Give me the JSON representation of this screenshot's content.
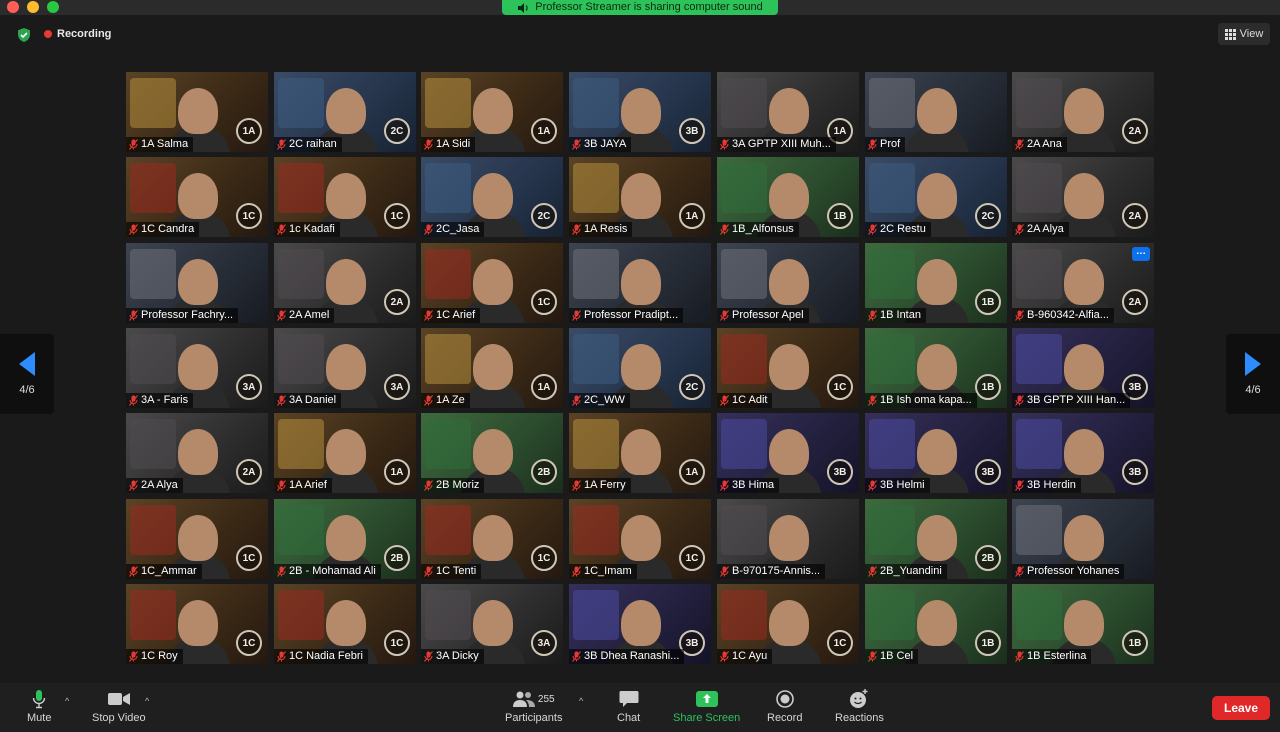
{
  "window": {
    "sharing_banner": "Professor Streamer is sharing computer sound",
    "recording_label": "Recording",
    "view_label": "View",
    "page_indicator": "4/6"
  },
  "participants": [
    {
      "name": "1A Salma",
      "badge": "1A",
      "house": "gold"
    },
    {
      "name": "2C raihan",
      "badge": "2C",
      "house": "blue"
    },
    {
      "name": "1A Sidi",
      "badge": "1A",
      "house": "gold"
    },
    {
      "name": "3B JAYA",
      "badge": "3B",
      "house": "blue"
    },
    {
      "name": "3A GPTP XIII Muh...",
      "badge": "1A",
      "house": "dark"
    },
    {
      "name": "Prof",
      "badge": "",
      "house": "prof"
    },
    {
      "name": "2A Ana",
      "badge": "2A",
      "house": "dark"
    },
    {
      "name": "1C Candra",
      "badge": "1C",
      "house": "red"
    },
    {
      "name": "1c Kadafi",
      "badge": "1C",
      "house": "red"
    },
    {
      "name": "2C_Jasa",
      "badge": "2C",
      "house": "blue"
    },
    {
      "name": "1A Resis",
      "badge": "1A",
      "house": "gold"
    },
    {
      "name": "1B_Alfonsus",
      "badge": "1B",
      "house": "green"
    },
    {
      "name": "2C Restu",
      "badge": "2C",
      "house": "blue"
    },
    {
      "name": "2A Alya",
      "badge": "2A",
      "house": "dark"
    },
    {
      "name": "Professor Fachry...",
      "badge": "",
      "house": "prof"
    },
    {
      "name": "2A Amel",
      "badge": "2A",
      "house": "dark"
    },
    {
      "name": "1C Arief",
      "badge": "1C",
      "house": "red"
    },
    {
      "name": "Professor Pradipt...",
      "badge": "",
      "house": "prof"
    },
    {
      "name": "Professor Apel",
      "badge": "",
      "house": "prof"
    },
    {
      "name": "1B Intan",
      "badge": "1B",
      "house": "green"
    },
    {
      "name": "B-960342-Alfia...",
      "badge": "2A",
      "house": "dark",
      "more": true
    },
    {
      "name": "3A - Faris",
      "badge": "3A",
      "house": "dark"
    },
    {
      "name": "3A Daniel",
      "badge": "3A",
      "house": "dark"
    },
    {
      "name": "1A Ze",
      "badge": "1A",
      "house": "gold"
    },
    {
      "name": "2C_WW",
      "badge": "2C",
      "house": "blue"
    },
    {
      "name": "1C Adit",
      "badge": "1C",
      "house": "red"
    },
    {
      "name": "1B Ish oma kapa...",
      "badge": "1B",
      "house": "green"
    },
    {
      "name": "3B GPTP XIII Han...",
      "badge": "3B",
      "house": "purple"
    },
    {
      "name": "2A Alya",
      "badge": "2A",
      "house": "dark"
    },
    {
      "name": "1A Arief",
      "badge": "1A",
      "house": "gold"
    },
    {
      "name": "2B Moriz",
      "badge": "2B",
      "house": "green"
    },
    {
      "name": "1A Ferry",
      "badge": "1A",
      "house": "gold"
    },
    {
      "name": "3B Hima",
      "badge": "3B",
      "house": "purple"
    },
    {
      "name": "3B Helmi",
      "badge": "3B",
      "house": "purple"
    },
    {
      "name": "3B Herdin",
      "badge": "3B",
      "house": "purple"
    },
    {
      "name": "1C_Ammar",
      "badge": "1C",
      "house": "red"
    },
    {
      "name": "2B - Mohamad Ali",
      "badge": "2B",
      "house": "green"
    },
    {
      "name": "1C Tenti",
      "badge": "1C",
      "house": "red"
    },
    {
      "name": "1C_Imam",
      "badge": "1C",
      "house": "red"
    },
    {
      "name": "B-970175-Annis...",
      "badge": "",
      "house": "dark"
    },
    {
      "name": "2B_Yuandini",
      "badge": "2B",
      "house": "green"
    },
    {
      "name": "Professor Yohanes",
      "badge": "",
      "house": "prof"
    },
    {
      "name": "1C Roy",
      "badge": "1C",
      "house": "red"
    },
    {
      "name": "1C Nadia Febri",
      "badge": "1C",
      "house": "red"
    },
    {
      "name": "3A Dicky",
      "badge": "3A",
      "house": "dark"
    },
    {
      "name": "3B Dhea Ranashi...",
      "badge": "3B",
      "house": "purple"
    },
    {
      "name": "1C Ayu",
      "badge": "1C",
      "house": "red"
    },
    {
      "name": "1B Cel",
      "badge": "1B",
      "house": "green"
    },
    {
      "name": "1B Esterlina",
      "badge": "1B",
      "house": "green"
    }
  ],
  "toolbar": {
    "mute_label": "Mute",
    "stop_video_label": "Stop Video",
    "participants_label": "Participants",
    "participants_count": "255",
    "chat_label": "Chat",
    "share_screen_label": "Share Screen",
    "record_label": "Record",
    "reactions_label": "Reactions",
    "leave_label": "Leave"
  },
  "colors": {
    "background": "#1a1a1a",
    "share_green": "#2ec25a",
    "leave_red": "#e02828",
    "record_dot": "#e53935",
    "muted_icon": "#e53935"
  }
}
